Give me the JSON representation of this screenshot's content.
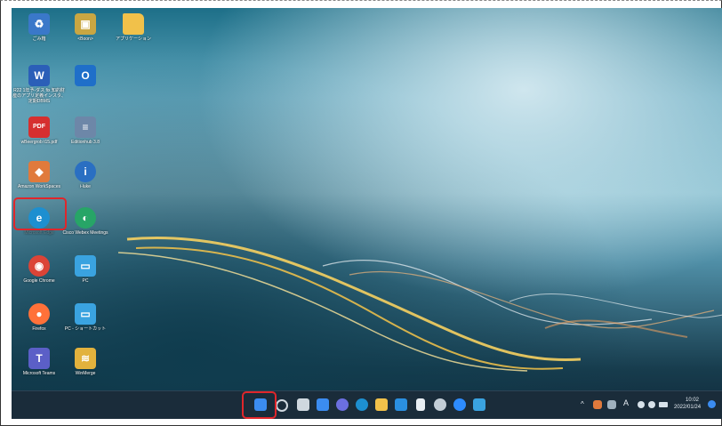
{
  "desktop": {
    "icons": [
      {
        "label": "ごみ箱",
        "icon": "recycle-bin-icon",
        "color": "#3a78c9",
        "glyph": "♻"
      },
      {
        "label": "<Boon>",
        "icon": "folder-user-icon",
        "color": "#c9a642",
        "glyph": "▣"
      },
      {
        "label": "アプリケーション",
        "icon": "folder-icon",
        "color": "#f1c14a",
        "glyph": ""
      },
      {
        "label": "R22 1年予-ダス fix 知的財産のアプリ定義インスタ、定期DBMS",
        "icon": "word-doc-icon",
        "color": "#2b5fb8",
        "glyph": "W"
      },
      {
        "label": "",
        "icon": "outlook-icon",
        "color": "#1f6fc9",
        "glyph": "O"
      },
      {
        "label": "wBeergrob t15.pdf",
        "icon": "pdf-icon",
        "color": "#d62f2f",
        "glyph": "PDF"
      },
      {
        "label": "Editionhub 3.8",
        "icon": "document-icon",
        "color": "#6d87a8",
        "glyph": "≡"
      },
      {
        "label": "Amazon WorkSpaces",
        "icon": "amazon-workspaces-icon",
        "color": "#e07a3c",
        "glyph": "◆"
      },
      {
        "label": "i-luke",
        "icon": "info-app-icon",
        "color": "#2a6fc2",
        "glyph": "i"
      },
      {
        "label": "Microsoft Edge",
        "icon": "edge-icon",
        "color": "#1d8fd0",
        "glyph": "e"
      },
      {
        "label": "Cisco Webex Meetings",
        "icon": "webex-icon",
        "color": "#27a567",
        "glyph": "◐"
      },
      {
        "label": "Google Chrome",
        "icon": "chrome-icon",
        "color": "#db4437",
        "glyph": "◉"
      },
      {
        "label": "PC",
        "icon": "pc-monitor-icon",
        "color": "#3aa3e0",
        "glyph": "▭"
      },
      {
        "label": "Firefox",
        "icon": "firefox-icon",
        "color": "#ff7139",
        "glyph": "●"
      },
      {
        "label": "PC - ショートカット",
        "icon": "pc-shortcut-icon",
        "color": "#3aa3e0",
        "glyph": "▭"
      },
      {
        "label": "Microsoft Teams",
        "icon": "teams-icon",
        "color": "#5b5fc7",
        "glyph": "T"
      },
      {
        "label": "WinMerge",
        "icon": "winmerge-icon",
        "color": "#e2b23d",
        "glyph": "≋"
      }
    ]
  },
  "taskbar": {
    "buttons": [
      {
        "name": "start-button",
        "icon": "windows-start-icon",
        "color": "#3b8cf0"
      },
      {
        "name": "search-button",
        "icon": "search-icon",
        "color": "#cfd8df"
      },
      {
        "name": "task-view-button",
        "icon": "task-view-icon",
        "color": "#cfd8df"
      },
      {
        "name": "widgets-button",
        "icon": "widgets-icon",
        "color": "#3b8cf0"
      },
      {
        "name": "chat-button",
        "icon": "chat-icon",
        "color": "#6b6fe0"
      },
      {
        "name": "edge-taskbar-button",
        "icon": "edge-icon",
        "color": "#1d8fd0"
      },
      {
        "name": "explorer-button",
        "icon": "folder-icon",
        "color": "#f1c14a"
      },
      {
        "name": "store-button",
        "icon": "store-icon",
        "color": "#2a8fe0"
      },
      {
        "name": "notepad-button",
        "icon": "document-icon",
        "color": "#e8eef3"
      },
      {
        "name": "settings-button",
        "icon": "gear-icon",
        "color": "#c2cdd6"
      },
      {
        "name": "zoom-button",
        "icon": "zoom-icon",
        "color": "#2d8cff"
      },
      {
        "name": "network-app-button",
        "icon": "app-icon",
        "color": "#3aa3e0"
      }
    ],
    "tray": {
      "chevron": "^",
      "ime": "A",
      "time": "10:02",
      "date": "2022/01/24"
    }
  }
}
